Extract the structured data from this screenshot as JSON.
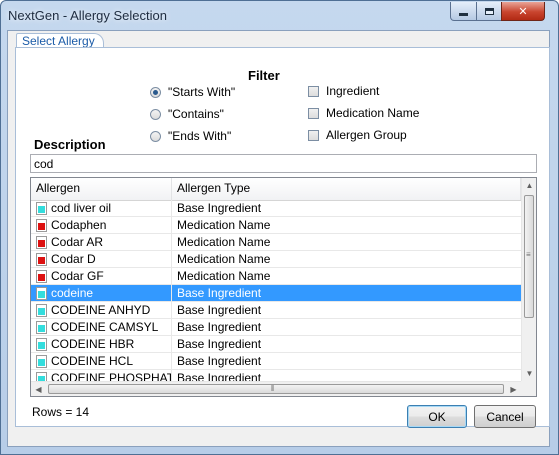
{
  "window": {
    "title": "NextGen - Allergy Selection"
  },
  "tab": {
    "label": "Select Allergy"
  },
  "filter": {
    "title": "Filter",
    "match_options": [
      {
        "label": "\"Starts With\"",
        "checked": true
      },
      {
        "label": "\"Contains\"",
        "checked": false
      },
      {
        "label": "\"Ends With\"",
        "checked": false
      }
    ],
    "type_options": [
      {
        "label": "Ingredient",
        "checked": false
      },
      {
        "label": "Medication Name",
        "checked": false
      },
      {
        "label": "Allergen Group",
        "checked": false
      }
    ]
  },
  "description": {
    "label": "Description",
    "value": "cod"
  },
  "grid": {
    "columns": [
      "Allergen",
      "Allergen Type"
    ],
    "rows": [
      {
        "allergen": "cod liver oil",
        "type": "Base Ingredient",
        "icon": "cyan-document-icon",
        "icon_color": "#33dddd",
        "selected": false
      },
      {
        "allergen": "Codaphen",
        "type": "Medication Name",
        "icon": "red-document-icon",
        "icon_color": "#dd1111",
        "selected": false
      },
      {
        "allergen": "Codar AR",
        "type": "Medication Name",
        "icon": "red-document-icon",
        "icon_color": "#dd1111",
        "selected": false
      },
      {
        "allergen": "Codar D",
        "type": "Medication Name",
        "icon": "red-document-icon",
        "icon_color": "#dd1111",
        "selected": false
      },
      {
        "allergen": "Codar GF",
        "type": "Medication Name",
        "icon": "red-document-icon",
        "icon_color": "#dd1111",
        "selected": false
      },
      {
        "allergen": "codeine",
        "type": "Base Ingredient",
        "icon": "cyan-document-icon",
        "icon_color": "#33dddd",
        "selected": true
      },
      {
        "allergen": "CODEINE ANHYD",
        "type": "Base Ingredient",
        "icon": "cyan-document-icon",
        "icon_color": "#33dddd",
        "selected": false
      },
      {
        "allergen": "CODEINE CAMSYL",
        "type": "Base Ingredient",
        "icon": "cyan-document-icon",
        "icon_color": "#33dddd",
        "selected": false
      },
      {
        "allergen": "CODEINE HBR",
        "type": "Base Ingredient",
        "icon": "cyan-document-icon",
        "icon_color": "#33dddd",
        "selected": false
      },
      {
        "allergen": "CODEINE HCL",
        "type": "Base Ingredient",
        "icon": "cyan-document-icon",
        "icon_color": "#33dddd",
        "selected": false
      },
      {
        "allergen": "CODEINE PHOSPHATE",
        "type": "Base Ingredient",
        "icon": "cyan-document-icon",
        "icon_color": "#33dddd",
        "selected": false
      }
    ],
    "selection_color": "#3399ff"
  },
  "status": {
    "rows_text": "Rows = 14"
  },
  "buttons": {
    "ok": "OK",
    "cancel": "Cancel"
  }
}
